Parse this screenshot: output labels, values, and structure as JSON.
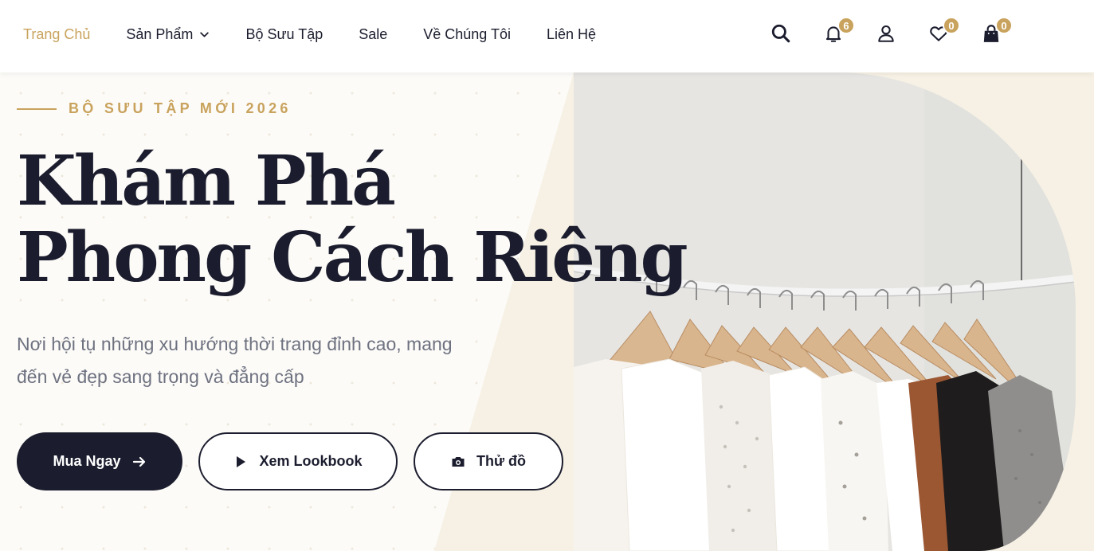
{
  "nav": {
    "items": [
      {
        "label": "Trang Chủ",
        "active": true
      },
      {
        "label": "Sản Phẩm",
        "has_dropdown": true
      },
      {
        "label": "Bộ Sưu Tập"
      },
      {
        "label": "Sale"
      },
      {
        "label": "Về Chúng Tôi"
      },
      {
        "label": "Liên Hệ"
      }
    ]
  },
  "icons": {
    "search": {
      "icon": "search-icon"
    },
    "notifications": {
      "icon": "bell-icon",
      "count": "6"
    },
    "account": {
      "icon": "user-icon"
    },
    "wishlist": {
      "icon": "heart-icon",
      "count": "0"
    },
    "cart": {
      "icon": "shopping-bag-icon",
      "count": "0"
    }
  },
  "hero": {
    "eyebrow": "BỘ SƯU TẬP MỚI 2026",
    "title_line1": "Khám Phá",
    "title_line2": "Phong Cách Riêng",
    "subtitle_line1": "Nơi hội tụ những xu hướng thời trang đỉnh cao, mang",
    "subtitle_line2": "đến vẻ đẹp sang trọng và đẳng cấp",
    "buttons": {
      "shop_now": "Mua Ngay",
      "lookbook": "Xem Lookbook",
      "try_on": "Thử đồ"
    }
  },
  "colors": {
    "accent": "#c9a35d",
    "dark": "#1b1d2e",
    "muted_text": "#6e7280"
  }
}
